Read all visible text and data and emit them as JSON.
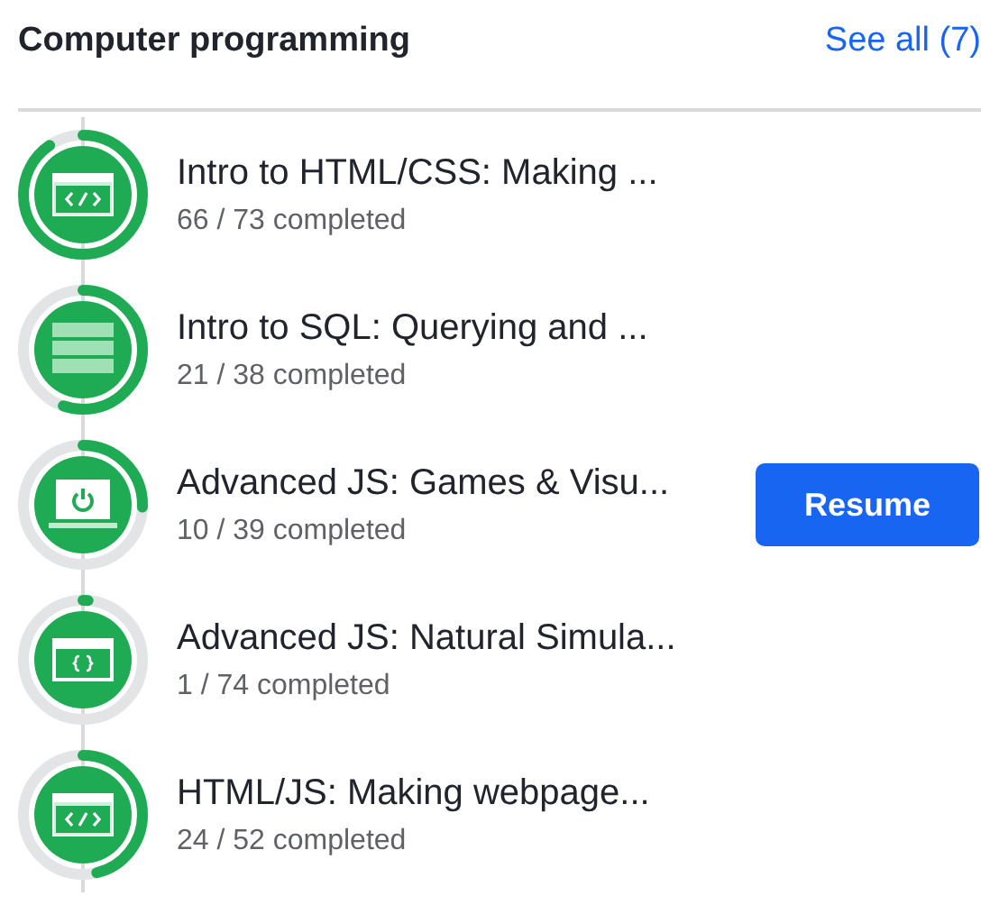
{
  "header": {
    "title": "Computer programming",
    "link": "See all (7)"
  },
  "courses": [
    {
      "title": "Intro to HTML/CSS: Making ...",
      "progress": "66 / 73 completed",
      "level": 0.904,
      "kind": "code"
    },
    {
      "title": "Intro to SQL: Querying and ...",
      "progress": "21 / 38 completed",
      "level": 0.553,
      "kind": "table"
    },
    {
      "title": "Advanced JS: Games & Visu...",
      "progress": "10 / 39 completed",
      "level": 0.256,
      "kind": "power",
      "action": "Resume"
    },
    {
      "title": "Advanced JS: Natural Simula...",
      "progress": "1 / 74 completed",
      "level": 0.014,
      "kind": "braces"
    },
    {
      "title": "HTML/JS: Making webpage...",
      "progress": "24 / 52 completed",
      "level": 0.462,
      "kind": "code"
    }
  ]
}
